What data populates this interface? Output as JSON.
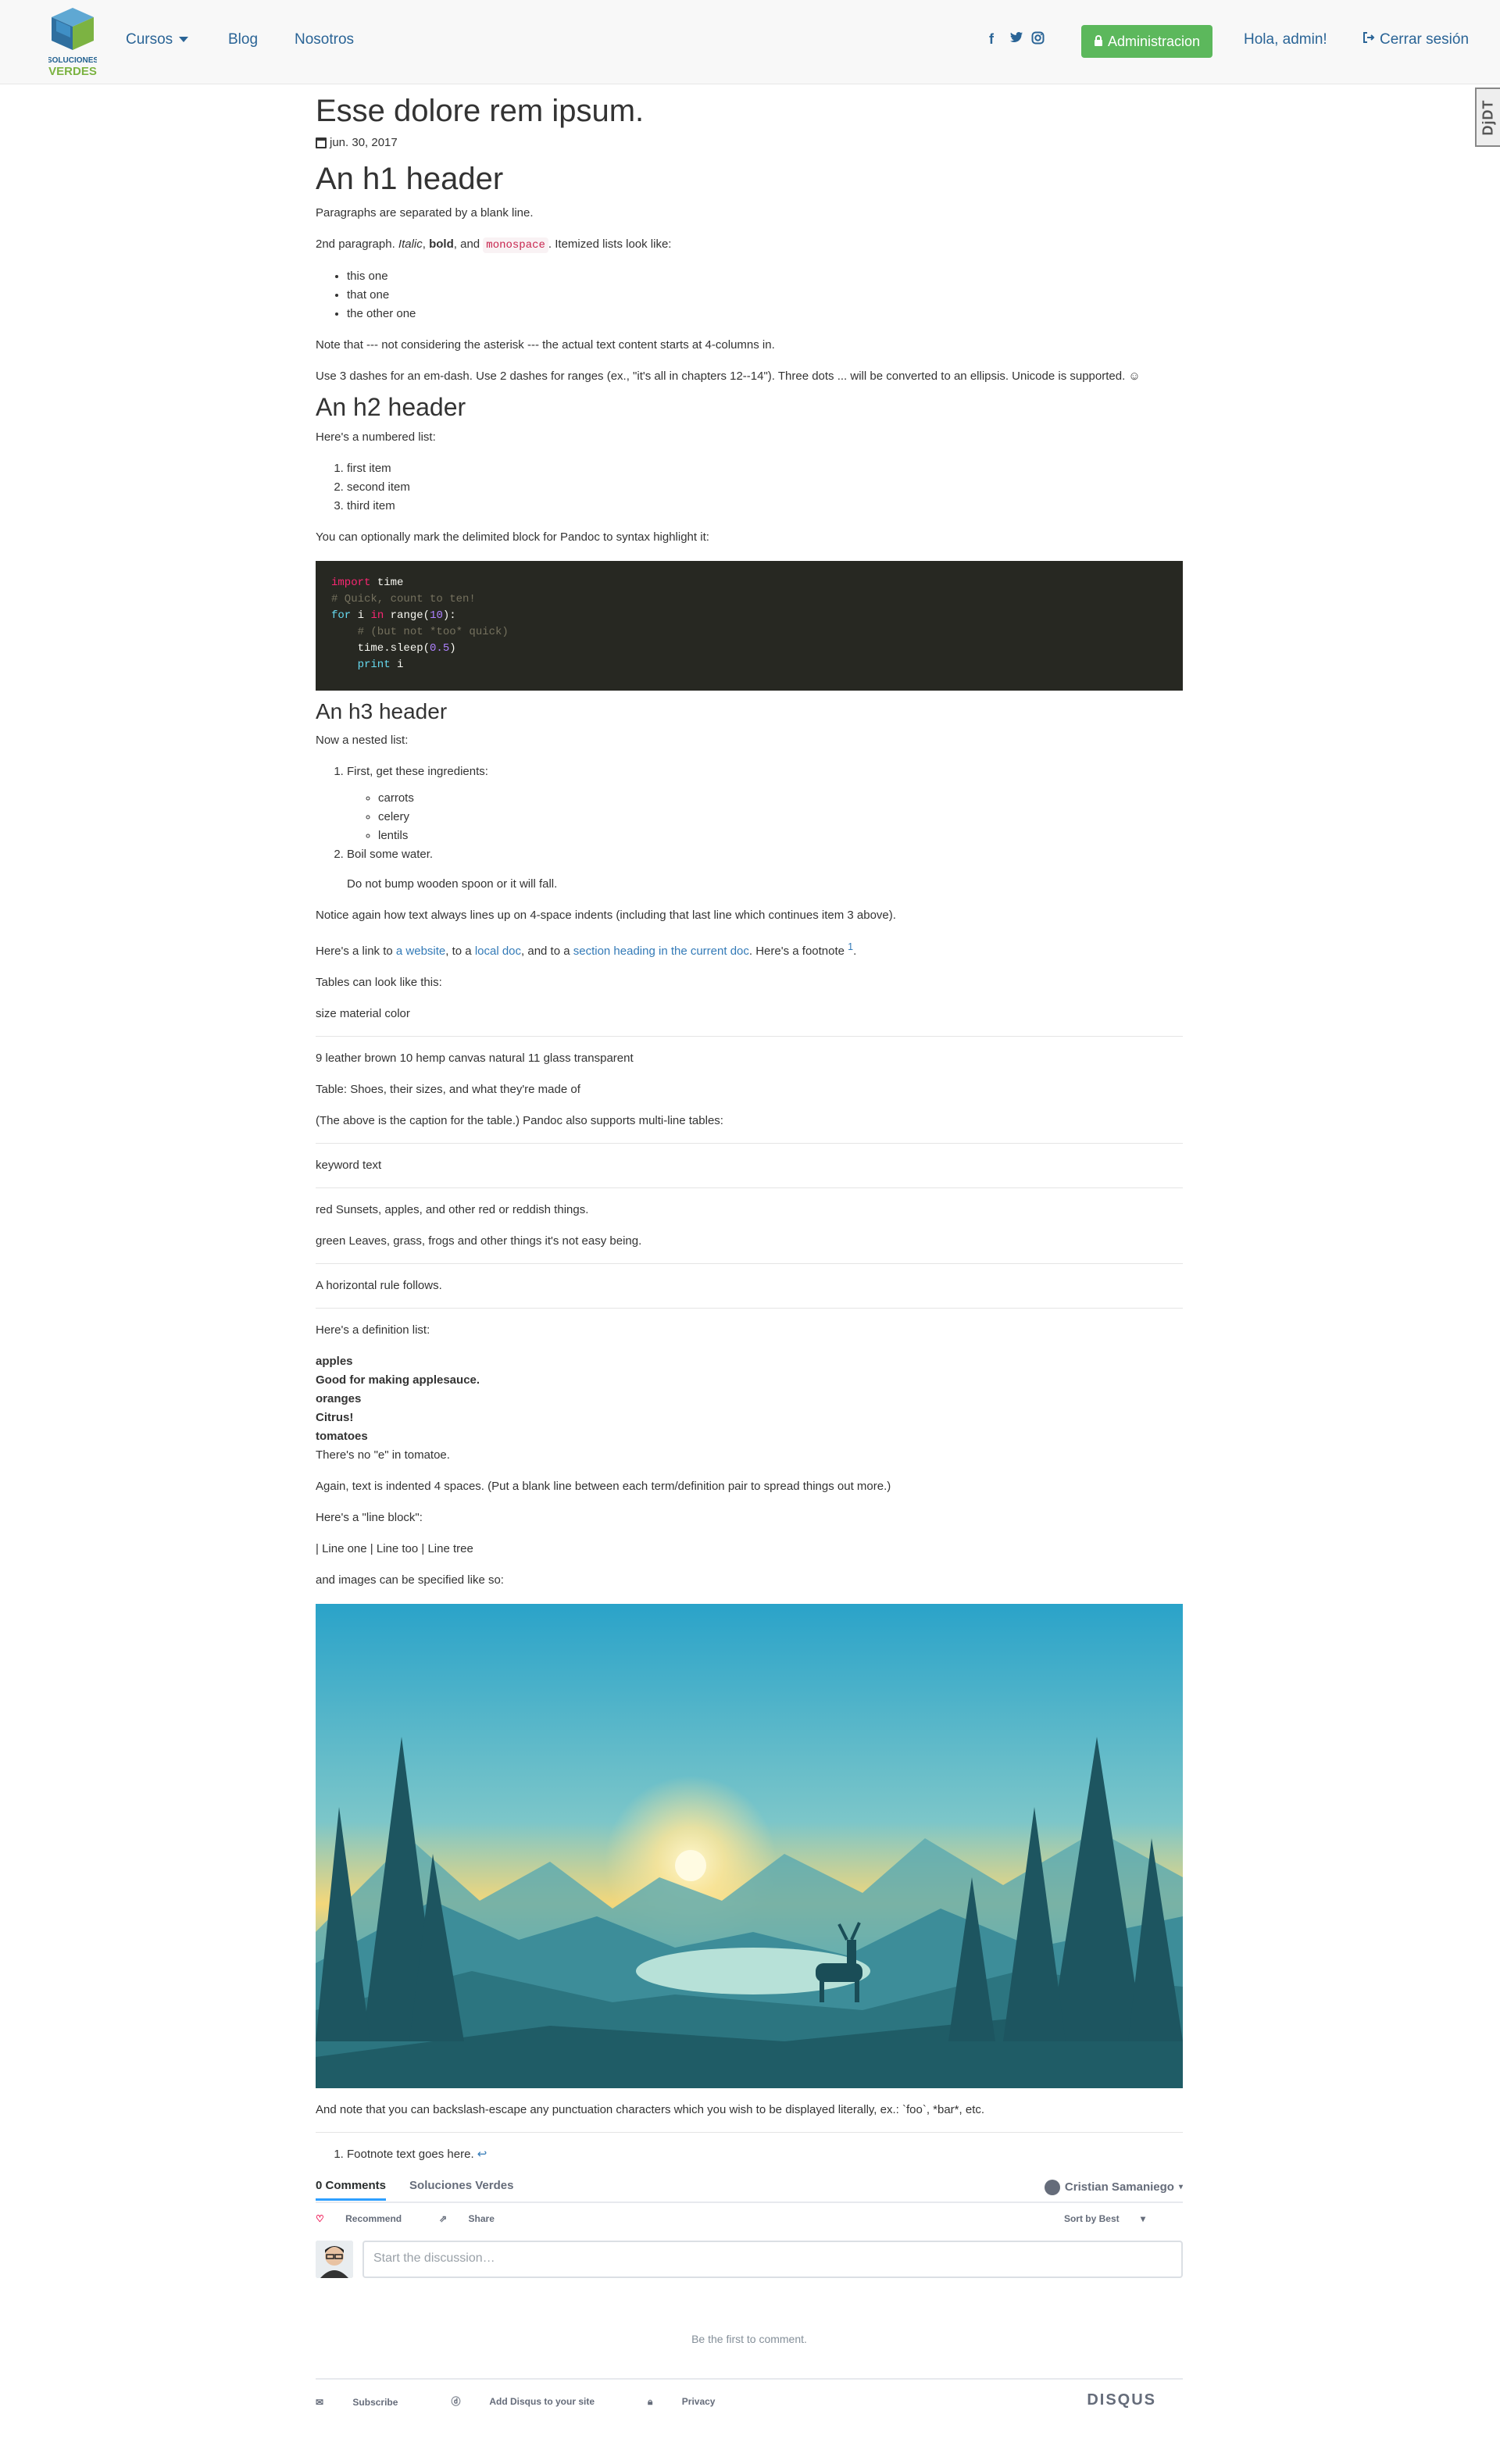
{
  "nav": {
    "brand_line1": "SOLUCIONES",
    "brand_line2": "VERDES",
    "courses": "Cursos",
    "blog": "Blog",
    "about": "Nosotros",
    "admin": "Administracion",
    "greeting": "Hola, admin!",
    "logout": "Cerrar sesión"
  },
  "debug_toolbar": "DjDT",
  "post": {
    "title": "Esse dolore rem ipsum.",
    "date": "jun. 30, 2017",
    "h1": "An h1 header",
    "p1": "Paragraphs are separated by a blank line.",
    "p2_pre": "2nd paragraph. ",
    "p2_italic": "Italic",
    "p2_sep1": ", ",
    "p2_bold": "bold",
    "p2_sep2": ", and ",
    "p2_mono": "monospace",
    "p2_post": ". Itemized lists look like:",
    "bullets": [
      "this one",
      "that one",
      "the other one"
    ],
    "p3": "Note that --- not considering the asterisk --- the actual text content starts at 4-columns in.",
    "p4": "Use 3 dashes for an em-dash. Use 2 dashes for ranges (ex., \"it's all in chapters 12--14\"). Three dots ... will be converted to an ellipsis. Unicode is supported. ☺",
    "h2": "An h2 header",
    "p5": "Here's a numbered list:",
    "numbered": [
      "first item",
      "second item",
      "third item"
    ],
    "p6": "You can optionally mark the delimited block for Pandoc to syntax highlight it:",
    "code": {
      "l1_kw": "import",
      "l1_rest": " time",
      "l2": "# Quick, count to ten!",
      "l3_for": "for",
      "l3_i": " i ",
      "l3_in": "in",
      "l3_range": " range(",
      "l3_num": "10",
      "l3_end": "):",
      "l4": "    # (but not *too* quick)",
      "l5_a": "    time.sleep(",
      "l5_num": "0.5",
      "l5_b": ")",
      "l6_print": "    print",
      "l6_rest": " i"
    },
    "h3": "An h3 header",
    "p7": "Now a nested list:",
    "nested_1": "First, get these ingredients:",
    "ingredients": [
      "carrots",
      "celery",
      "lentils"
    ],
    "nested_2": "Boil some water.",
    "nested_note": "Do not bump wooden spoon or it will fall.",
    "p8": "Notice again how text always lines up on 4-space indents (including that last line which continues item 3 above).",
    "p9_a": "Here's a link to ",
    "p9_link1": "a website",
    "p9_b": ", to a ",
    "p9_link2": "local doc",
    "p9_c": ", and to a ",
    "p9_link3": "section heading in the current doc",
    "p9_d": ". Here's a footnote ",
    "p9_fn": "1",
    "p9_e": ".",
    "p10": "Tables can look like this:",
    "table_head": "size material color",
    "table_body": "9 leather brown 10 hemp canvas natural 11 glass transparent",
    "table_caption": "Table: Shoes, their sizes, and what they're made of",
    "p11": "(The above is the caption for the table.) Pandoc also supports multi-line tables:",
    "ml_head": "keyword text",
    "ml_row1": "red Sunsets, apples, and other red or reddish things.",
    "ml_row2": "green Leaves, grass, frogs and other things it's not easy being.",
    "p12": "A horizontal rule follows.",
    "p13": "Here's a definition list:",
    "dl": {
      "t1": "apples",
      "d1": "Good for making applesauce.",
      "t2": "oranges",
      "d2": "Citrus!",
      "t3": "tomatoes",
      "d3": "There's no \"e\" in tomatoe."
    },
    "p14": "Again, text is indented 4 spaces. (Put a blank line between each term/definition pair to spread things out more.)",
    "p15": "Here's a \"line block\":",
    "p16": "| Line one | Line too | Line tree",
    "p17": "and images can be specified like so:",
    "p18": "And note that you can backslash-escape any punctuation characters which you wish to be displayed literally, ex.: `foo`, *bar*, etc.",
    "footnote": "Footnote text goes here.",
    "footnote_back": "↩"
  },
  "disqus": {
    "comments_tab": "0 Comments",
    "site_tab": "Soluciones Verdes",
    "user": "Cristian Samaniego",
    "recommend": "Recommend",
    "share": "Share",
    "sort": "Sort by Best",
    "placeholder": "Start the discussion…",
    "empty": "Be the first to comment.",
    "subscribe": "Subscribe",
    "add_disqus": "Add Disqus to your site",
    "privacy": "Privacy",
    "brand": "DISQUS"
  },
  "colors": {
    "link": "#2a6496",
    "admin_btn": "#5cb85c",
    "code_bg": "#272822",
    "disqus_accent": "#2e9fff"
  }
}
